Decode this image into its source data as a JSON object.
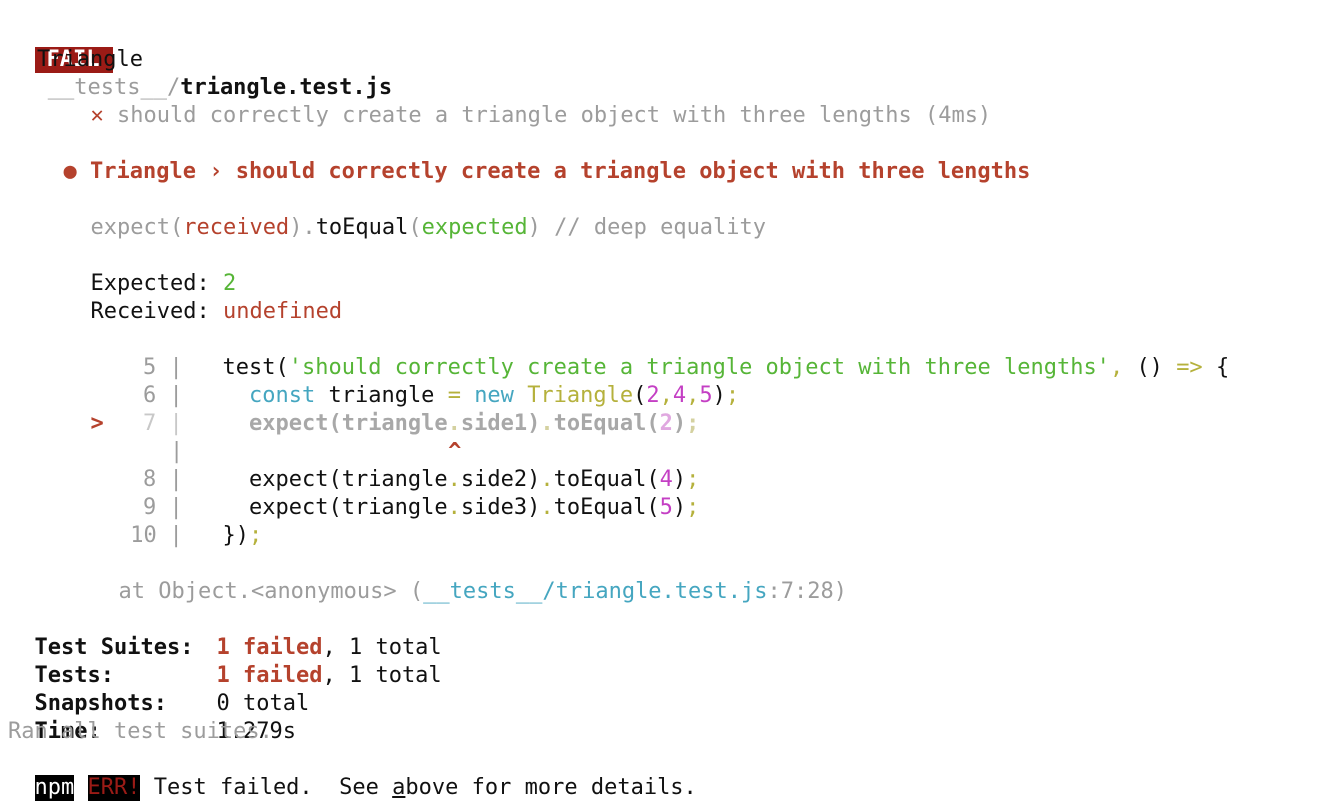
{
  "header": {
    "badge": "FAIL",
    "path_dir": "__tests__/",
    "path_file": "triangle.test.js"
  },
  "suite": {
    "describe": "Triangle",
    "fail_mark": "✕",
    "test_name": "should correctly create a triangle object with three lengths (4ms)"
  },
  "error": {
    "bullet": "●",
    "title": "Triangle › should correctly create a triangle object with three lengths",
    "matcher_expect": "expect(",
    "matcher_received": "received",
    "matcher_mid": ").",
    "matcher_fn": "toEqual",
    "matcher_open": "(",
    "matcher_expected": "expected",
    "matcher_close": ") // deep equality",
    "expected_label": "Expected: ",
    "expected_value": "2",
    "received_label": "Received: ",
    "received_value": "undefined"
  },
  "code": {
    "marker": ">",
    "lines": [
      {
        "num": "5",
        "sep": "|"
      },
      {
        "num": "6",
        "sep": "|"
      },
      {
        "num": "7",
        "sep": "|"
      },
      {
        "num": "",
        "sep": "|"
      },
      {
        "num": "8",
        "sep": "|"
      },
      {
        "num": "9",
        "sep": "|"
      },
      {
        "num": "10",
        "sep": "|"
      }
    ],
    "l5_test": "test(",
    "l5_string": "'should correctly create a triangle object with three lengths'",
    "l5_comma": ",",
    "l5_parens": "()",
    "l5_arrow": "=>",
    "l5_brace": "{",
    "l6_const": "const",
    "l6_var": "triangle",
    "l6_eq": "=",
    "l6_new": "new",
    "l6_class": "Triangle",
    "l6_open": "(",
    "l6_a": "2",
    "l6_comma1": ",",
    "l6_b": "4",
    "l6_comma2": ",",
    "l6_c": "5",
    "l6_close": ")",
    "l6_semi": ";",
    "l7_a": "expect(triangle",
    "l7_dot": ".",
    "l7_b": "side1)",
    "l7_dot2": ".",
    "l7_c": "toEqual(",
    "l7_num": "2",
    "l7_d": ")",
    "l7_semi": ";",
    "caret": "^",
    "l8_a": "expect(triangle",
    "l8_dot": ".",
    "l8_b": "side2)",
    "l8_dot2": ".",
    "l8_c": "toEqual(",
    "l8_num": "4",
    "l8_d": ")",
    "l8_semi": ";",
    "l9_a": "expect(triangle",
    "l9_dot": ".",
    "l9_b": "side3)",
    "l9_dot2": ".",
    "l9_c": "toEqual(",
    "l9_num": "5",
    "l9_d": ")",
    "l9_semi": ";",
    "l10_a": "})",
    "l10_semi": ";"
  },
  "stack": {
    "prefix": "at Object.<anonymous> (",
    "path": "__tests__/triangle.test.js",
    "location": ":7:28)"
  },
  "summary": {
    "suites_label": "Test Suites:",
    "suites_failed": "1 failed",
    "suites_total": ", 1 total",
    "tests_label": "Tests:",
    "tests_failed": "1 failed",
    "tests_total": ", 1 total",
    "snapshots_label": "Snapshots:",
    "snapshots_value": "0 total",
    "time_label": "Time:",
    "time_value": "1.279s",
    "ran_all": "Ran all test suites."
  },
  "npm": {
    "npm_badge": "npm",
    "err_badge": "ERR!",
    "message_a": "Test failed.  See ",
    "message_cursor": "a",
    "message_b": "bove for more details."
  },
  "colors": {
    "fail_badge_bg": "#9b1b16",
    "red": "#b5422d",
    "green": "#56b537",
    "cyan": "#45a6c0",
    "yellow": "#b5b13c",
    "magenta": "#c43fc4",
    "dim": "#9c9c9c"
  }
}
